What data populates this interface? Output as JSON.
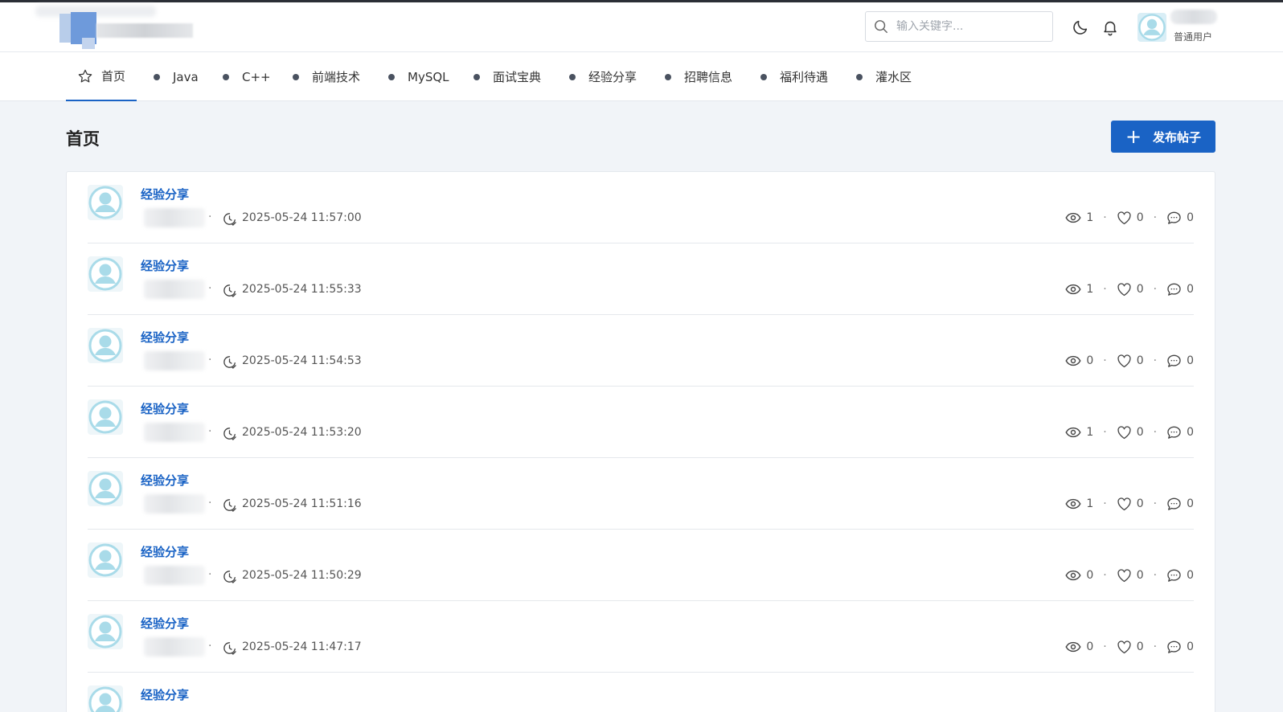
{
  "header": {
    "search_placeholder": "输入关键字...",
    "user_role": "普通用户"
  },
  "nav": {
    "items": [
      {
        "label": "首页",
        "active": true
      },
      {
        "label": "Java"
      },
      {
        "label": "C++"
      },
      {
        "label": "前端技术"
      },
      {
        "label": "MySQL"
      },
      {
        "label": "面试宝典"
      },
      {
        "label": "经验分享"
      },
      {
        "label": "招聘信息"
      },
      {
        "label": "福利待遇"
      },
      {
        "label": "灌水区"
      }
    ]
  },
  "page": {
    "title": "首页",
    "publish_label": "发布帖子"
  },
  "posts": [
    {
      "tag": "经验分享",
      "time": "2025-05-24 11:57:00",
      "views": "1",
      "likes": "0",
      "comments": "0"
    },
    {
      "tag": "经验分享",
      "time": "2025-05-24 11:55:33",
      "views": "1",
      "likes": "0",
      "comments": "0"
    },
    {
      "tag": "经验分享",
      "time": "2025-05-24 11:54:53",
      "views": "0",
      "likes": "0",
      "comments": "0"
    },
    {
      "tag": "经验分享",
      "time": "2025-05-24 11:53:20",
      "views": "1",
      "likes": "0",
      "comments": "0"
    },
    {
      "tag": "经验分享",
      "time": "2025-05-24 11:51:16",
      "views": "1",
      "likes": "0",
      "comments": "0"
    },
    {
      "tag": "经验分享",
      "time": "2025-05-24 11:50:29",
      "views": "0",
      "likes": "0",
      "comments": "0"
    },
    {
      "tag": "经验分享",
      "time": "2025-05-24 11:47:17",
      "views": "0",
      "likes": "0",
      "comments": "0"
    },
    {
      "tag": "经验分享"
    }
  ],
  "colors": {
    "accent": "#1a63c5",
    "avatar": "#a9dbe9"
  }
}
